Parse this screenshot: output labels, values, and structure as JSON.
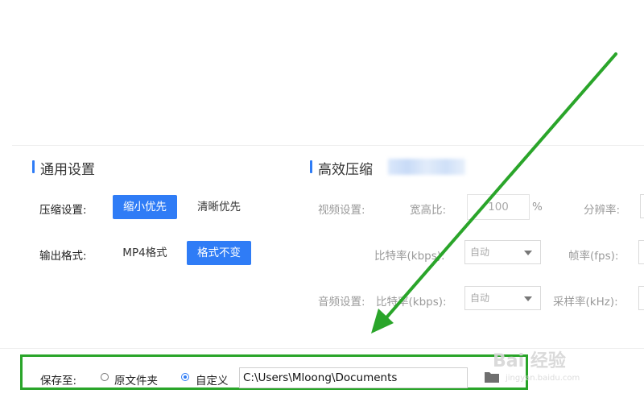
{
  "general": {
    "title": "通用设置",
    "compress_label": "压缩设置:",
    "compress_options": [
      "缩小优先",
      "清晰优先"
    ],
    "output_label": "输出格式:",
    "output_options": [
      "MP4格式",
      "格式不变"
    ]
  },
  "efficient": {
    "title": "高效压缩",
    "video_label": "视频设置:",
    "aspect_label": "宽高比:",
    "aspect_value": "100",
    "aspect_unit": "%",
    "resolution_label": "分辨率:",
    "bitrate_label": "比特率(kbps):",
    "bitrate_value": "自动",
    "fps_label": "帧率(fps):",
    "audio_label": "音频设置:",
    "audio_bitrate_label": "比特率(kbps):",
    "audio_bitrate_value": "自动",
    "samplerate_label": "采样率(kHz):"
  },
  "save": {
    "label": "保存至:",
    "option_original": "原文件夹",
    "option_custom": "自定义",
    "selected": "自定义",
    "path": "C:\\Users\\Mloong\\Documents"
  },
  "watermark": {
    "brand": "Bai 经验",
    "url": "jingyan.baidu.com"
  },
  "colors": {
    "accent": "#2f7cf6",
    "highlight": "#2aa52a"
  }
}
